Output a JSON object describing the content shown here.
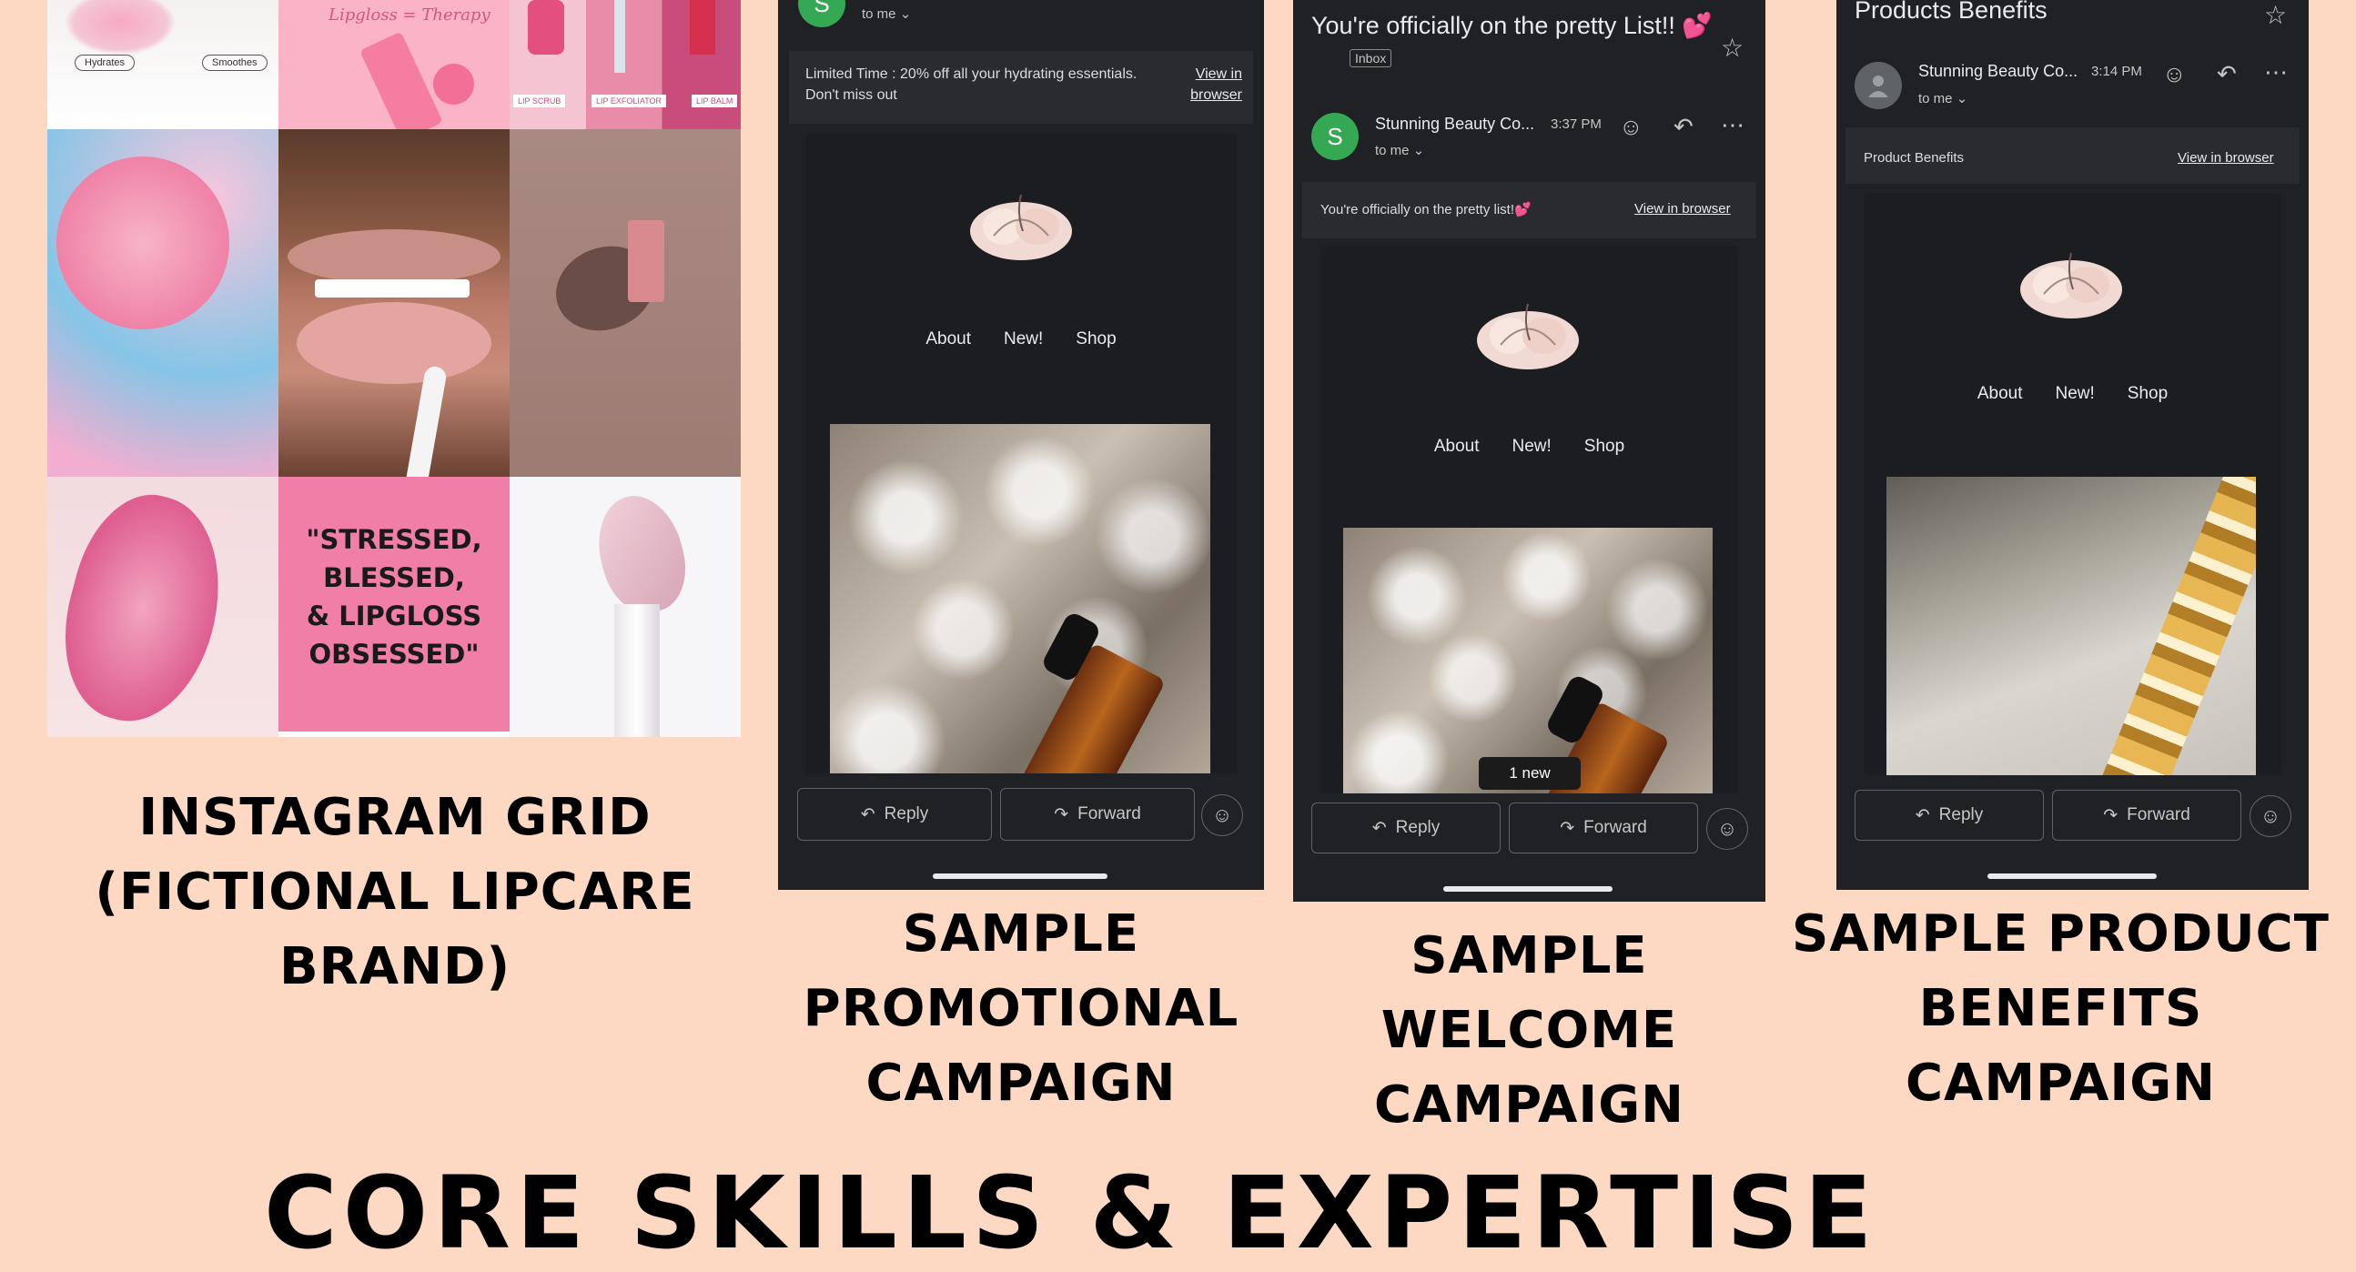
{
  "grid": {
    "tiles": [
      {
        "labels": [
          "Hydrates",
          "Smoothes"
        ]
      },
      {
        "labels": [
          "Lipgloss = Therapy"
        ]
      },
      {
        "labels": [
          "LIP SCRUB",
          "LIP EXFOLIATOR",
          "LIP BALM"
        ]
      },
      {
        "labels": []
      },
      {
        "labels": []
      },
      {
        "labels": []
      },
      {
        "labels": []
      },
      {
        "labels": [
          "\"STRESSED,",
          "BLESSED,",
          "& LIPGLOSS",
          "OBSESSED\""
        ]
      },
      {
        "labels": []
      }
    ]
  },
  "captions": {
    "grid": [
      "INSTAGRAM GRID",
      "(FICTIONAL LIPCARE BRAND)"
    ],
    "promo": [
      "SAMPLE",
      "PROMOTIONAL",
      "CAMPAIGN"
    ],
    "welcome": [
      "SAMPLE",
      "WELCOME",
      "CAMPAIGN"
    ],
    "benefits": [
      "SAMPLE PRODUCT",
      "BENEFITS",
      "CAMPAIGN"
    ],
    "bottom": "CORE SKILLS & EXPERTISE"
  },
  "promo": {
    "avatar": "S",
    "to": "to me",
    "preheader": "Limited Time : 20% off all your hydrating essentials. Don't miss out",
    "view_in_browser": "View in browser",
    "nav": [
      "About",
      "New!",
      "Shop"
    ],
    "reply": "Reply",
    "forward": "Forward"
  },
  "welcome": {
    "subject": "You're officially on the pretty List!! 💕",
    "inbox_badge": "Inbox",
    "avatar": "S",
    "sender": "Stunning Beauty Co...",
    "time": "3:37 PM",
    "to": "to me",
    "preheader": "You're officially on the pretty list!💕",
    "view_in_browser": "View in browser",
    "nav": [
      "About",
      "New!",
      "Shop"
    ],
    "new_badge": "1 new",
    "reply": "Reply",
    "forward": "Forward"
  },
  "benefits": {
    "subject": "Products Benefits",
    "sender": "Stunning Beauty Co...",
    "time": "3:14 PM",
    "to": "to me",
    "preheader": "Product Benefits",
    "view_in_browser": "View in browser",
    "nav": [
      "About",
      "New!",
      "Shop"
    ],
    "reply": "Reply",
    "forward": "Forward"
  },
  "colors": {
    "background": "#fdd9c4",
    "email_bg": "#202124",
    "avatar_green": "#34a853"
  }
}
